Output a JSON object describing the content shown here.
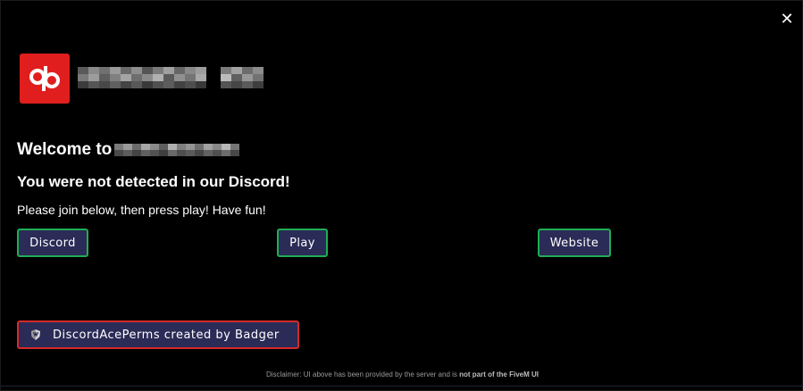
{
  "window": {
    "close_glyph": "✕"
  },
  "header": {
    "logo_icon": "qb-logo-icon",
    "logo_color": "#e01e1e"
  },
  "content": {
    "welcome_prefix": "Welcome to",
    "headline": "You were not detected in our Discord!",
    "subtext": "Please join below, then press play! Have fun!"
  },
  "buttons": {
    "discord": "Discord",
    "play": "Play",
    "website": "Website"
  },
  "credit": {
    "icon": "badger-icon",
    "label": "DiscordAcePerms created by Badger"
  },
  "footer": {
    "disclaimer_prefix": "Disclaimer: UI above has been provided by the server and is ",
    "disclaimer_bold": "not part of the FiveM UI"
  },
  "colors": {
    "background": "#000000",
    "button_bg": "#2b2b57",
    "button_border_green": "#1fae55",
    "credit_border_red": "#d42a2a",
    "text": "#ffffff"
  }
}
